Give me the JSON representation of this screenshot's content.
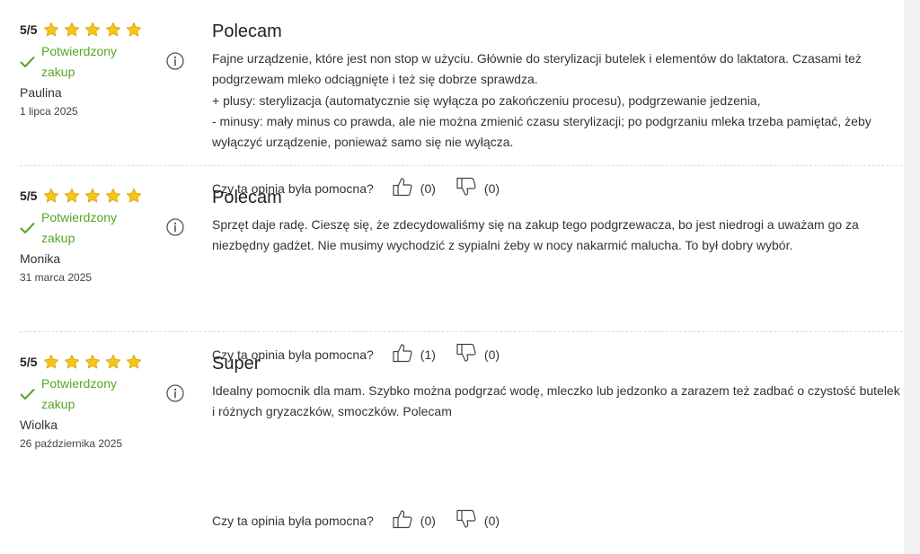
{
  "reviews": [
    {
      "score": "5/5",
      "rating": 5,
      "verified_label": "Potwierdzony zakup",
      "author": "Paulina",
      "date": "1 lipca 2025",
      "title": "Polecam",
      "body": [
        "Fajne urządzenie, które jest non stop w użyciu. Głównie do sterylizacji butelek i elementów do laktatora. Czasami też podgrzewam mleko odciągnięte i też się dobrze sprawdza.",
        "+ plusy: sterylizacja (automatycznie się wyłącza po zakończeniu procesu), podgrzewanie jedzenia,",
        "- minusy: mały minus co prawda, ale nie można zmienić czasu sterylizacji; po podgrzaniu mleka trzeba pamiętać, żeby wyłączyć urządzenie, ponieważ samo się nie wyłącza."
      ],
      "helpful_question": "Czy ta opinia była pomocna?",
      "upvotes": "(0)",
      "downvotes": "(0)"
    },
    {
      "score": "5/5",
      "rating": 5,
      "verified_label": "Potwierdzony zakup",
      "author": "Monika",
      "date": "31 marca 2025",
      "title": "Polecam",
      "body": [
        "Sprzęt daje radę. Cieszę się, że zdecydowaliśmy się na zakup tego podgrzewacza, bo jest niedrogi a uważam go za niezbędny gadżet. Nie musimy wychodzić z sypialni żeby w nocy nakarmić malucha. To był dobry wybór."
      ],
      "helpful_question": "Czy ta opinia była pomocna?",
      "upvotes": "(1)",
      "downvotes": "(0)"
    },
    {
      "score": "5/5",
      "rating": 5,
      "verified_label": "Potwierdzony zakup",
      "author": "Wiolka",
      "date": "26 października 2025",
      "title": "Super",
      "body": [
        "Idealny pomocnik dla mam. Szybko można podgrzać wodę, mleczko lub jedzonko a zarazem też zadbać o czystość butelek i różnych gryzaczków, smoczków. Polecam"
      ],
      "helpful_question": "Czy ta opinia była pomocna?",
      "upvotes": "(0)",
      "downvotes": "(0)"
    }
  ],
  "colors": {
    "star": "#f5c518",
    "star_outline": "#d9a300",
    "verified": "#57a524",
    "divider": "#dcdcdc"
  },
  "icons": [
    "star-icon",
    "check-icon",
    "info-icon",
    "thumbs-up-icon",
    "thumbs-down-icon"
  ]
}
